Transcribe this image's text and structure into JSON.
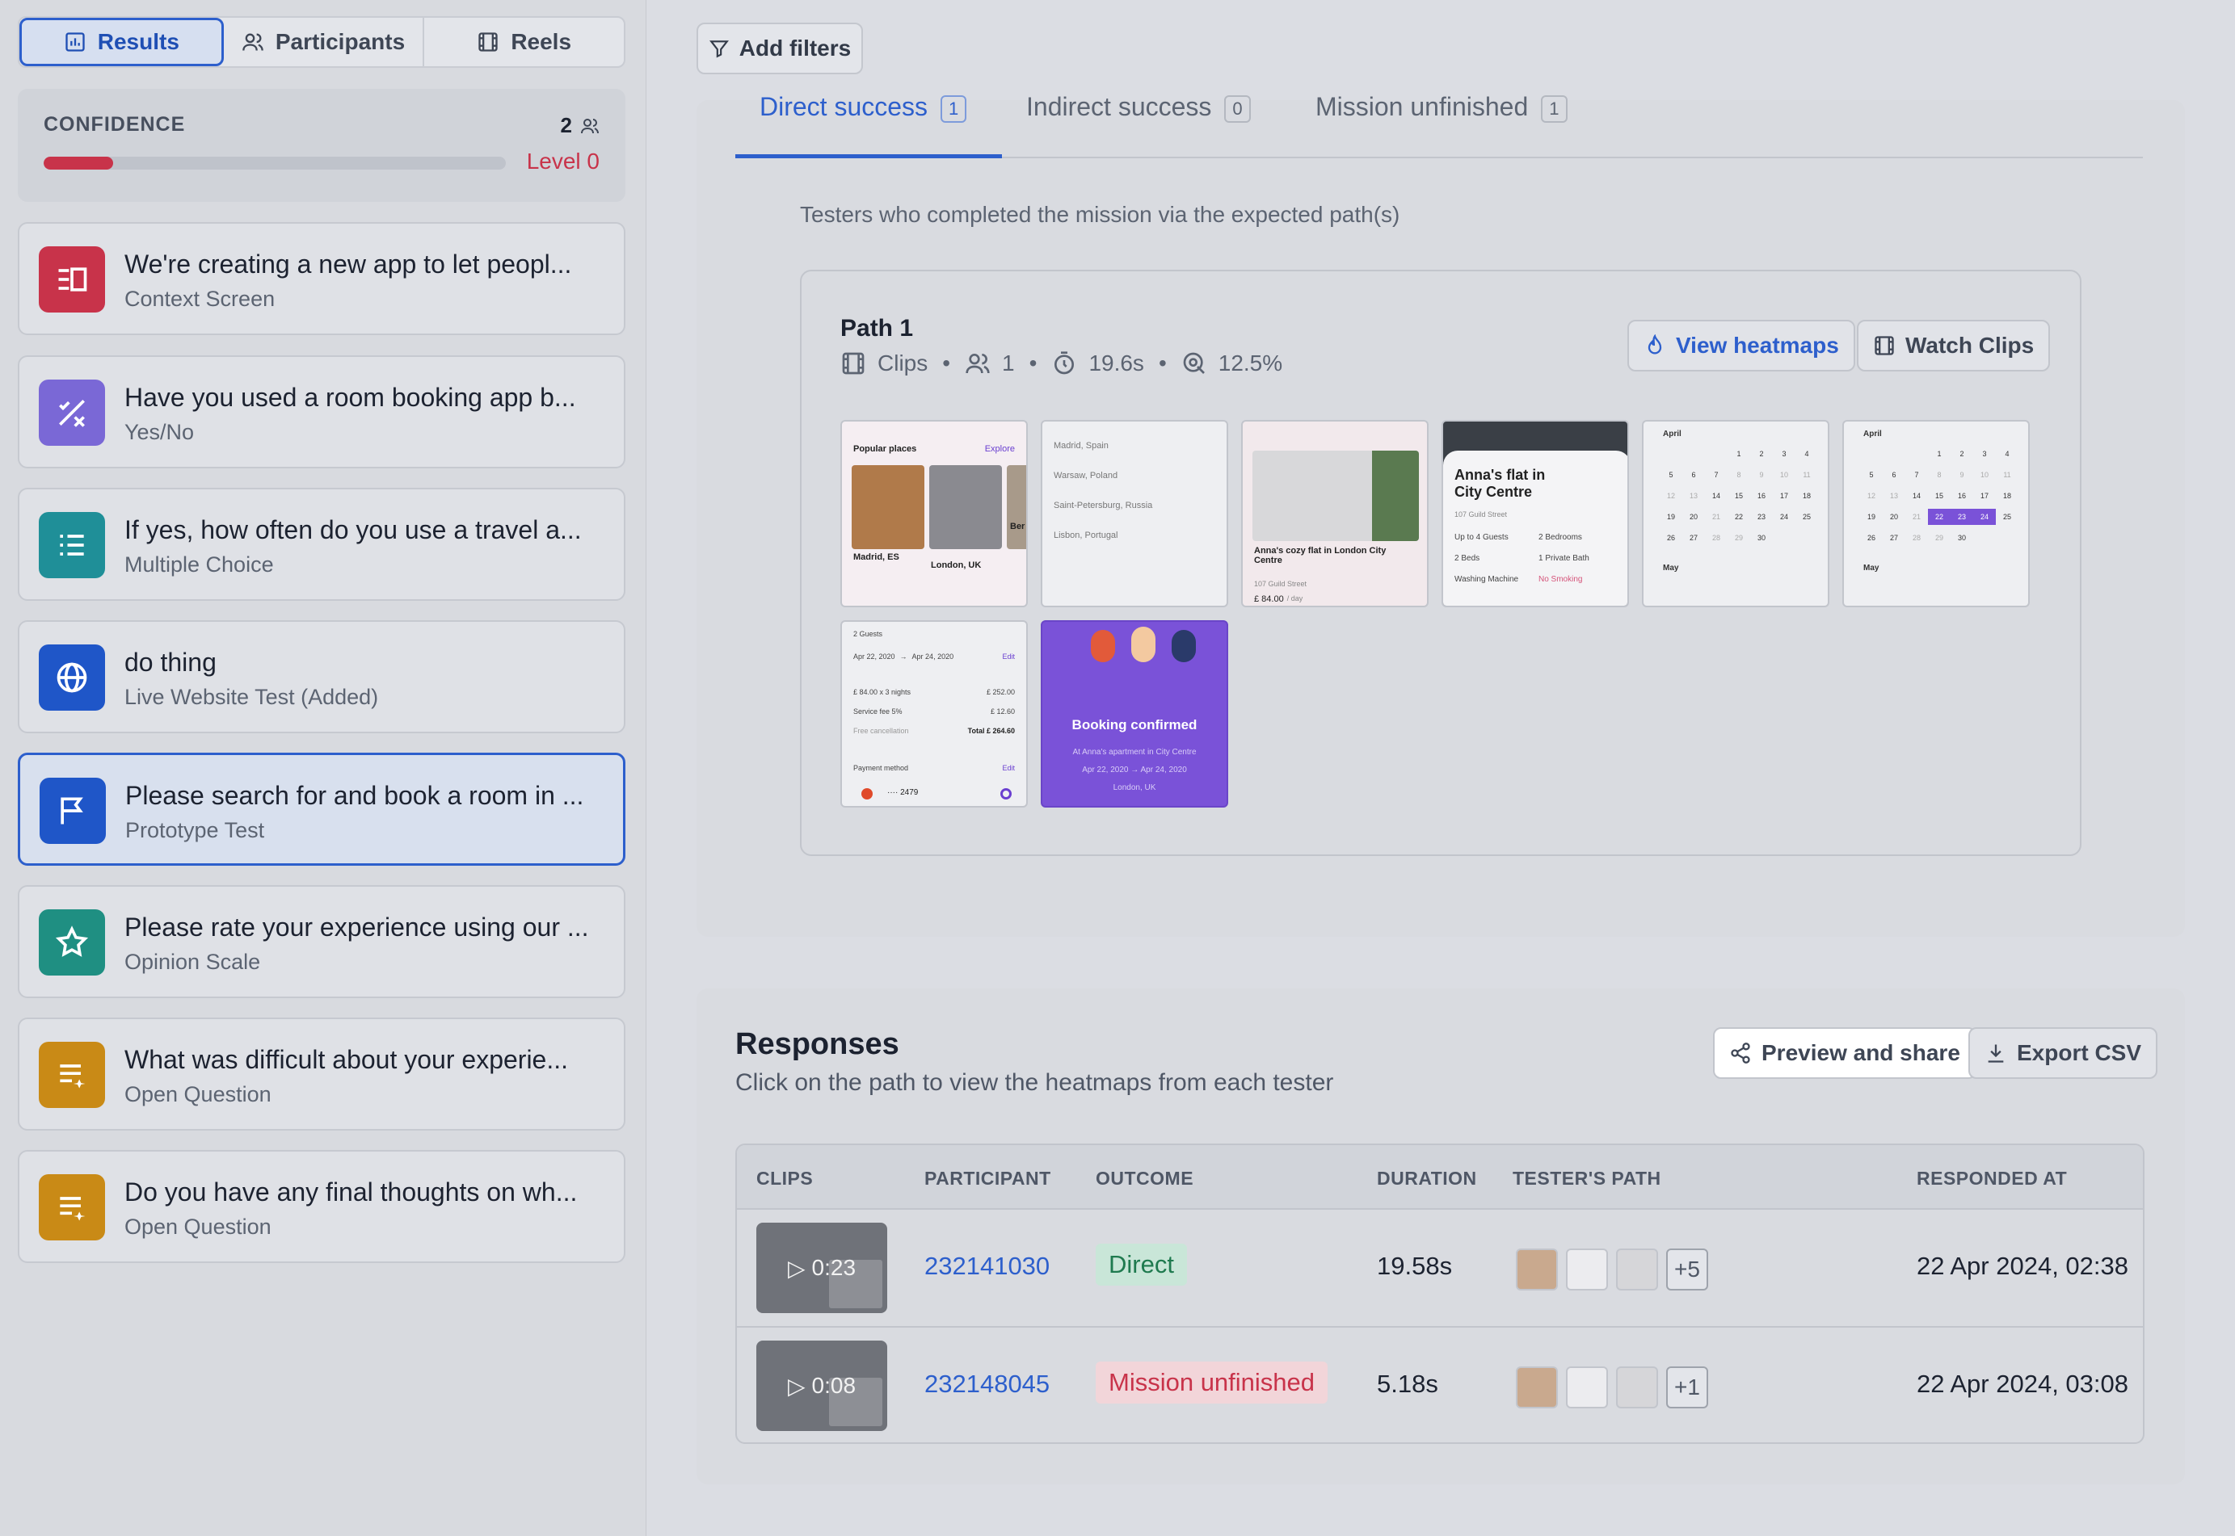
{
  "nav": {
    "tabs": [
      {
        "label": "Results"
      },
      {
        "label": "Participants"
      },
      {
        "label": "Reels"
      }
    ]
  },
  "confidence": {
    "label": "CONFIDENCE",
    "count": "2",
    "level": "Level 0",
    "progress": 0.15
  },
  "blocks": [
    {
      "title": "We're creating a new app to let peopl...",
      "type": "Context Screen",
      "color": "#c8334a",
      "icon": "context-icon"
    },
    {
      "title": "Have you used a room booking app b...",
      "type": "Yes/No",
      "color": "#7a68d6",
      "icon": "yes-no-icon"
    },
    {
      "title": "If yes, how often do you use a travel a...",
      "type": "Multiple Choice",
      "color": "#1f8f98",
      "icon": "list-icon"
    },
    {
      "title": "do thing",
      "type": "Live Website Test (Added)",
      "color": "#1f56c8",
      "icon": "globe-icon"
    },
    {
      "title": "Please search for and book a room in ...",
      "type": "Prototype Test",
      "color": "#1f56c8",
      "icon": "flag-icon"
    },
    {
      "title": "Please rate your experience using our ...",
      "type": "Opinion Scale",
      "color": "#1f8f82",
      "icon": "star-icon"
    },
    {
      "title": "What was difficult about your experie...",
      "type": "Open Question",
      "color": "#c98a16",
      "icon": "open-question-icon"
    },
    {
      "title": "Do you have any final thoughts on wh...",
      "type": "Open Question",
      "color": "#c98a16",
      "icon": "open-question-icon"
    }
  ],
  "filters": {
    "add_label": "Add filters"
  },
  "outcome_tabs": [
    {
      "label": "Direct success",
      "count": "1"
    },
    {
      "label": "Indirect success",
      "count": "0"
    },
    {
      "label": "Mission unfinished",
      "count": "1"
    }
  ],
  "description": "Testers who completed the mission via the expected path(s)",
  "path": {
    "title": "Path 1",
    "clips_label": "Clips",
    "participants": "1",
    "duration": "19.6s",
    "rate": "12.5%",
    "view_heatmaps": "View heatmaps",
    "watch_clips": "Watch Clips"
  },
  "screens": {
    "popular": {
      "heading": "Popular places",
      "explore": "Explore",
      "city1": "Madrid, ES",
      "city2": "London, UK",
      "city3": "Ber"
    },
    "search": {
      "items": [
        "Madrid, Spain",
        "Warsaw, Poland",
        "Saint-Petersburg, Russia",
        "Lisbon, Portugal"
      ]
    },
    "listing": {
      "title": "Anna's cozy flat in London City Centre",
      "street": "107 Guild Street",
      "price": "£ 84.00",
      "per": "/ day"
    },
    "detail": {
      "title": "Anna's flat in City Centre",
      "street": "107 Guild Street",
      "f1": "Up to 4 Guests",
      "f2": "2 Bedrooms",
      "f3": "2 Beds",
      "f4": "1 Private Bath",
      "f5": "Washing Machine",
      "f6": "No Smoking"
    },
    "calendar": {
      "month1": "April",
      "month2": "May"
    },
    "summary": {
      "guests": "2 Guests",
      "from": "Apr 22, 2020",
      "to": "Apr 24, 2020",
      "edit": "Edit",
      "l1": "£ 84.00 x 3 nights",
      "v1": "£ 252.00",
      "l2": "Service fee 5%",
      "v2": "£ 12.60",
      "l3": "Free cancellation",
      "total": "Total £ 264.60",
      "payment": "Payment method",
      "card": "···· 2479"
    },
    "confirmed": {
      "title": "Booking confirmed",
      "sub": "At Anna's apartment in City Centre",
      "dates": "Apr 22, 2020 → Apr 24, 2020",
      "city": "London, UK"
    }
  },
  "responses": {
    "title": "Responses",
    "subtitle": "Click on the path to view the heatmaps from each tester",
    "preview_share": "Preview and share",
    "export_csv": "Export CSV",
    "columns": [
      "CLIPS",
      "PARTICIPANT",
      "OUTCOME",
      "DURATION",
      "TESTER'S PATH",
      "RESPONDED AT"
    ],
    "rows": [
      {
        "clip": "0:23",
        "participant": "232141030",
        "outcome": "Direct",
        "duration": "19.58s",
        "more": "+5",
        "responded": "22 Apr 2024, 02:38"
      },
      {
        "clip": "0:08",
        "participant": "232148045",
        "outcome": "Mission unfinished",
        "duration": "5.18s",
        "more": "+1",
        "responded": "22 Apr 2024, 03:08"
      }
    ]
  }
}
